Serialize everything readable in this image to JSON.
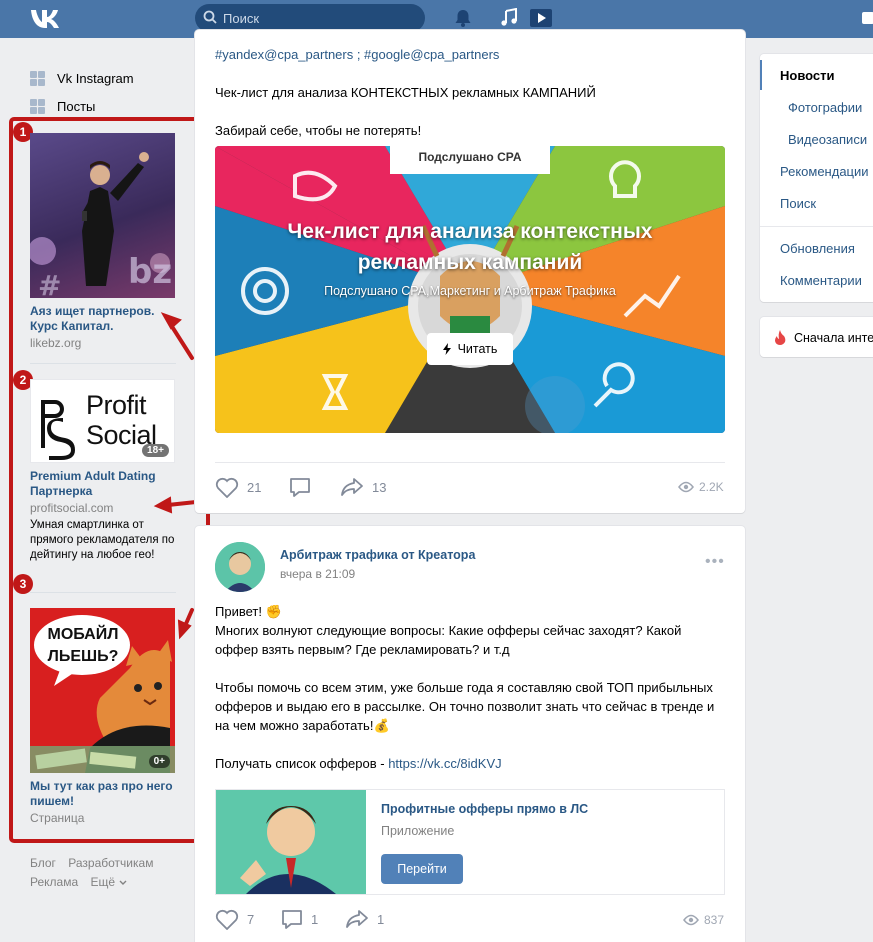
{
  "header": {
    "search_placeholder": "Поиск"
  },
  "leftnav": {
    "items": [
      {
        "label": "Vk Instagram"
      },
      {
        "label": "Посты"
      }
    ]
  },
  "annotations": {
    "badges": [
      "1",
      "2",
      "3"
    ],
    "color": "#c01818"
  },
  "ads": [
    {
      "title": "Аяз ищет партнеров. Курс Капитал.",
      "domain": "likebz.org"
    },
    {
      "image_text_line1": "Profit",
      "image_text_line2": "Social",
      "age": "18+",
      "title": "Premium Adult Dating Партнерка",
      "domain": "profitsocial.com",
      "description": "Умная смартлинка от прямого рекламодателя по дейтингу на любое гео!"
    },
    {
      "image_text_line1": "МОБАЙЛ",
      "image_text_line2": "ЛЬЕШЬ?",
      "age": "0+",
      "title": "Мы тут как раз про него пишем!",
      "domain": "Страница"
    }
  ],
  "footer": {
    "links": [
      "Блог",
      "Разработчикам",
      "Реклама",
      "Ещё"
    ]
  },
  "post1": {
    "hashtags": "#yandex@cpa_partners ; #google@cpa_partners",
    "line1": "Чек-лист для анализа КОНТЕКСТНЫХ рекламных КАМПАНИЙ",
    "line2": "Забирай себе, чтобы не потерять!",
    "banner": {
      "top_label": "Подслушано CPA",
      "title_line1": "Чек-лист для анализа контекстных",
      "title_line2": "рекламных кампаний",
      "subtitle": "Подслушано CPA,Маркетинг и Арбитраж Трафика",
      "button": "Читать"
    },
    "likes": "21",
    "shares": "13",
    "views": "2.2K"
  },
  "post2": {
    "author": "Арбитраж трафика от Креатора",
    "time": "вчера в 21:09",
    "text_lines": [
      "Привет! ✊",
      "Многих волнуют следующие вопросы: Какие офферы сейчас заходят? Какой",
      "оффер взять первым? Где рекламировать? и т.д",
      "",
      "Чтобы помочь со всем этим, уже больше года я составляю свой ТОП прибыльных",
      "офферов и выдаю его в рассылке. Он точно позволит знать что сейчас в тренде и",
      "на чем можно заработать!💰",
      "",
      "Получать список офферов - "
    ],
    "link": "https://vk.cc/8idKVJ",
    "app": {
      "title": "Профитные офферы прямо в ЛС",
      "type": "Приложение",
      "button": "Перейти"
    },
    "likes": "7",
    "comments": "1",
    "shares": "1",
    "views": "837"
  },
  "rightnav": {
    "items": [
      "Новости",
      "Фотографии",
      "Видеозаписи",
      "Рекомендации",
      "Поиск",
      "Обновления",
      "Комментарии"
    ],
    "sort_label": "Сначала интересные"
  },
  "colors": {
    "header": "#4a76a8",
    "link": "#2a5885",
    "button": "#5181b8",
    "background": "#edeef0"
  }
}
